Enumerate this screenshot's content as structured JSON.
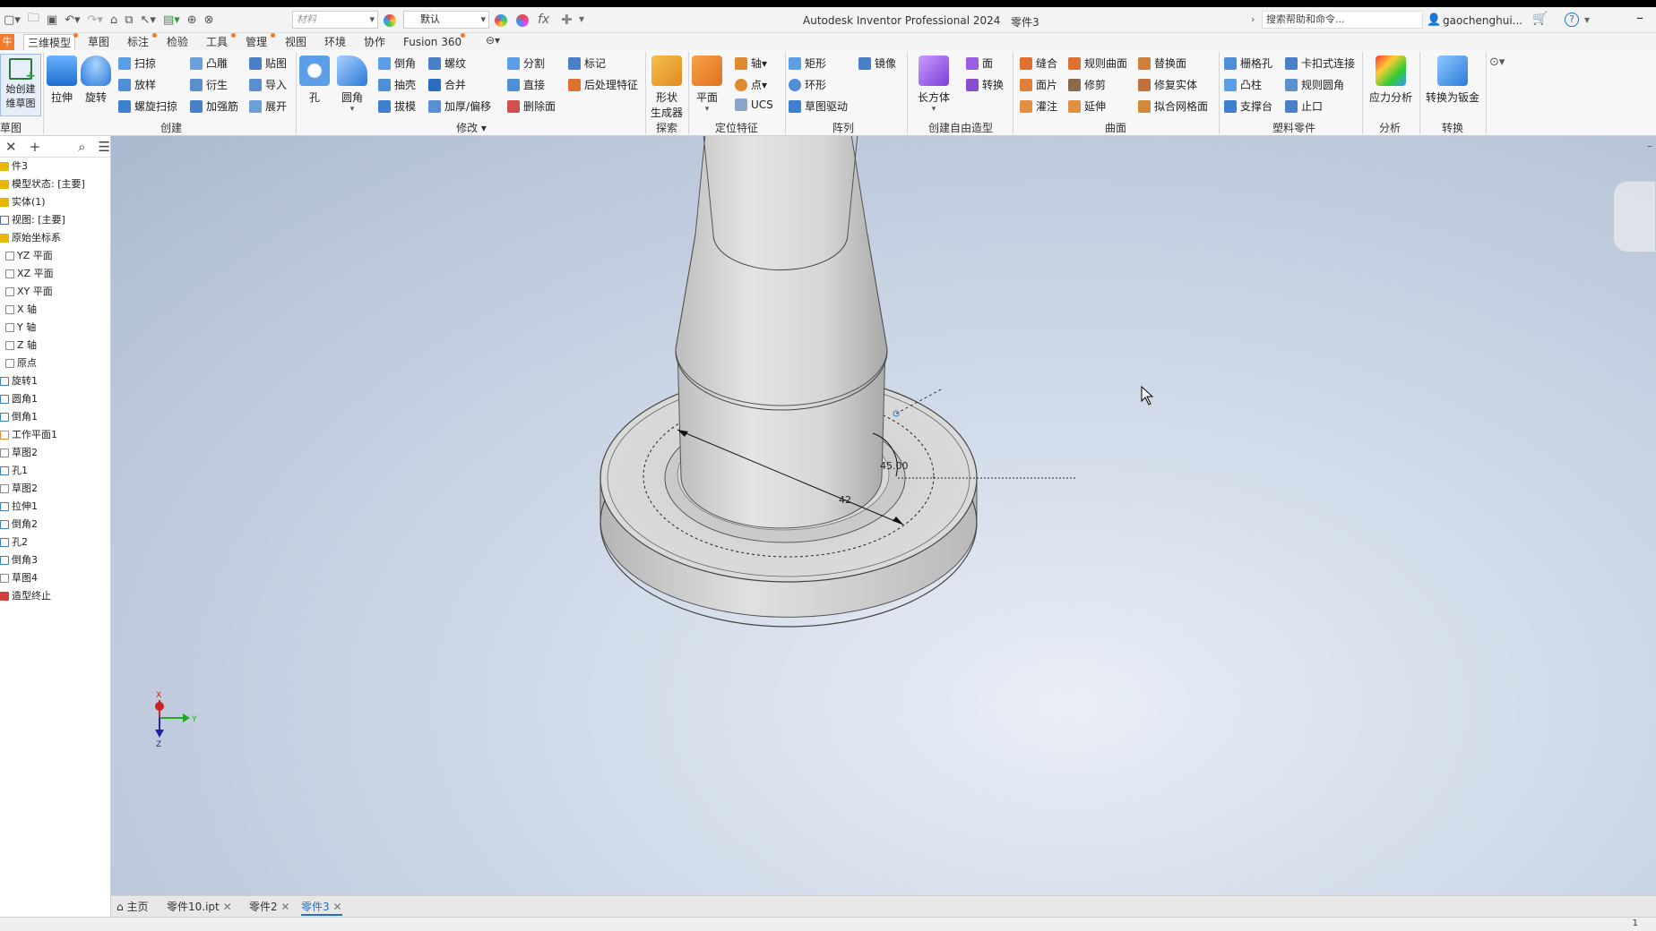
{
  "app": {
    "title": "Autodesk Inventor Professional 2024",
    "document": "零件3",
    "material_placeholder": "材料",
    "appearance": "默认",
    "fx": "fx",
    "search_placeholder": "搜索帮助和命令...",
    "user": "gaochenghui...",
    "help": "?"
  },
  "tabs": [
    {
      "label": "三维模型",
      "active": true
    },
    {
      "label": "草图",
      "active": false
    },
    {
      "label": "标注",
      "active": false
    },
    {
      "label": "检验",
      "active": false
    },
    {
      "label": "工具",
      "active": false
    },
    {
      "label": "管理",
      "active": false
    },
    {
      "label": "视图",
      "active": false
    },
    {
      "label": "环境",
      "active": false
    },
    {
      "label": "协作",
      "active": false
    },
    {
      "label": "Fusion 360",
      "active": false
    }
  ],
  "ribbon": {
    "sketch": {
      "start_label_1": "始创建",
      "start_label_2": "维草图",
      "group": "草图"
    },
    "create": {
      "group": "创建",
      "extrude": "拉伸",
      "revolve": "旋转",
      "sweep": "扫掠",
      "loft": "放样",
      "coil": "螺旋扫掠",
      "emboss": "凸雕",
      "derive": "衍生",
      "rib": "加强筋",
      "decal": "贴图",
      "import": "导入",
      "unfold": "展开"
    },
    "modify": {
      "group": "修改",
      "hole": "孔",
      "fillet": "圆角",
      "chamfer": "倒角",
      "shell": "抽壳",
      "draft": "拔模",
      "thread": "螺纹",
      "combine": "合并",
      "thicken": "加厚/偏移",
      "split": "分割",
      "direct": "直接",
      "delete_face": "删除面",
      "mark": "标记",
      "post": "后处理特征"
    },
    "explore": {
      "group": "探索",
      "shape_gen_1": "形状",
      "shape_gen_2": "生成器"
    },
    "work": {
      "group": "定位特征",
      "plane": "平面",
      "axis": "轴",
      "point": "点",
      "ucs": "UCS"
    },
    "pattern": {
      "group": "阵列",
      "rect": "矩形",
      "circ": "环形",
      "sketch_driven": "草图驱动",
      "mirror": "镜像"
    },
    "freeform": {
      "group": "创建自由造型",
      "box": "长方体",
      "face": "面",
      "convert": "转换"
    },
    "surface": {
      "group": "曲面",
      "stitch": "缝合",
      "patch": "面片",
      "sculpt": "灌注",
      "ruled": "规则曲面",
      "trim": "修剪",
      "extend": "延伸",
      "replace": "替换面",
      "repair": "修复实体",
      "mesh": "拟合网格面"
    },
    "plastic": {
      "group": "塑料零件",
      "grill": "栅格孔",
      "boss": "凸柱",
      "rest": "支撑台",
      "snap": "卡扣式连接",
      "rule_fillet": "规则圆角",
      "lip": "止口"
    },
    "analysis": {
      "group": "分析",
      "stress": "应力分析"
    },
    "convert": {
      "group": "转换",
      "sheet": "转换为钣金"
    }
  },
  "browser": {
    "items": [
      "件3",
      "模型状态: [主要]",
      "实体(1)",
      "视图: [主要]",
      "原始坐标系",
      "YZ 平面",
      "XZ 平面",
      "XY 平面",
      "X 轴",
      "Y 轴",
      "Z 轴",
      "原点",
      "旋转1",
      "圆角1",
      "倒角1",
      "工作平面1",
      "草图2",
      "孔1",
      "草图2",
      "拉伸1",
      "倒角2",
      "孔2",
      "倒角3",
      "草图4",
      "造型终止"
    ]
  },
  "viewport": {
    "dim_diameter": "42",
    "dim_angle": "45.00",
    "triad": {
      "x": "X",
      "y": "Y",
      "z": "Z"
    }
  },
  "doc_tabs": [
    {
      "label": "主页",
      "active": false
    },
    {
      "label": "零件10.ipt",
      "active": false
    },
    {
      "label": "零件2",
      "active": false
    },
    {
      "label": "零件3",
      "active": true
    }
  ],
  "status": {
    "page": "1"
  }
}
